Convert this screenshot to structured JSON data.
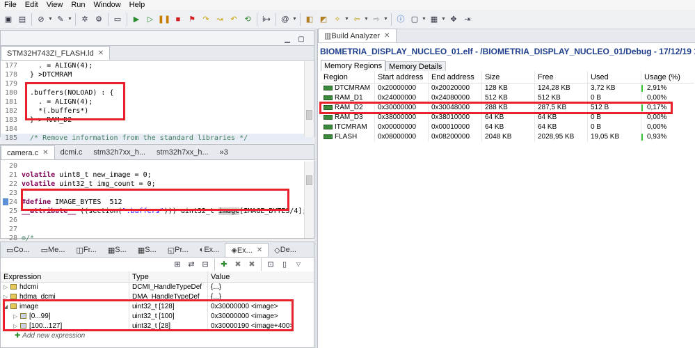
{
  "menu": [
    "File",
    "Edit",
    "Source",
    "Refactor",
    "Navigate",
    "Search",
    "Project",
    "Run",
    "Window",
    "Help"
  ],
  "menu_visible": [
    "File",
    "Edit",
    "View",
    "Run",
    "Window",
    "Help"
  ],
  "linker_editor": {
    "tab_label": "STM32H743ZI_FLASH.ld",
    "lines": [
      {
        "n": "177",
        "t": "    . = ALIGN(4);"
      },
      {
        "n": "178",
        "t": "  } >DTCMRAM"
      },
      {
        "n": "179",
        "t": ""
      },
      {
        "n": "180",
        "t": "  .buffers(NOLOAD) : {"
      },
      {
        "n": "181",
        "t": "    . = ALIGN(4);"
      },
      {
        "n": "182",
        "t": "    *(.buffers*)"
      },
      {
        "n": "183",
        "t": "  } > RAM_D2"
      },
      {
        "n": "184",
        "t": ""
      },
      {
        "n": "185",
        "t": "  /* Remove information from the standard libraries */"
      }
    ]
  },
  "c_editor": {
    "tabs": [
      "camera.c",
      "dcmi.c",
      "stm32h7xx_h...",
      "stm32h7xx_h...",
      "»3"
    ],
    "lines": [
      {
        "n": "20",
        "t": ""
      },
      {
        "n": "21",
        "kw": "volatile",
        "rest": " uint8_t new_image = 0;"
      },
      {
        "n": "22",
        "kw": "volatile",
        "rest": " uint32_t img_count = 0;"
      },
      {
        "n": "23",
        "t": ""
      },
      {
        "n": "24",
        "define": "#define",
        "rest": " IMAGE_BYTES  512"
      },
      {
        "n": "25",
        "attr": "__attribute__",
        "mid": " ((section(",
        "str": "\".buffers\"",
        "mid2": "))) uint32_t ",
        "hl": "image",
        "rest": "[IMAGE_BYTES/4];"
      },
      {
        "n": "26",
        "t": ""
      },
      {
        "n": "27",
        "t": ""
      },
      {
        "n": "28",
        "t": "⊖/*"
      }
    ]
  },
  "bottom_tabs": [
    "Co...",
    "Me...",
    "Fr...",
    "S...",
    "S...",
    "Pr...",
    "Ex...",
    "Ex...",
    "De..."
  ],
  "expressions": {
    "headers": [
      "Expression",
      "Type",
      "Value"
    ],
    "rows": [
      {
        "name": "hdcmi",
        "type": "DCMI_HandleTypeDef",
        "value": "{...}",
        "indent": 0
      },
      {
        "name": "hdma_dcmi",
        "type": "DMA_HandleTypeDef",
        "value": "{...}",
        "indent": 0
      },
      {
        "name": "image",
        "type": "uint32_t [128]",
        "value": "0x30000000 <image>",
        "indent": 0
      },
      {
        "name": "[0...99]",
        "type": "uint32_t [100]",
        "value": "0x30000000 <image>",
        "indent": 1
      },
      {
        "name": "[100...127]",
        "type": "uint32_t [28]",
        "value": "0x30000190 <image+400>",
        "indent": 1
      }
    ],
    "add_label": "Add new expression"
  },
  "build_analyzer": {
    "view_tab": "Build Analyzer",
    "title": "BIOMETRIA_DISPLAY_NUCLEO_01.elf - /BIOMETRIA_DISPLAY_NUCLEO_01/Debug - 17/12/19 11:51",
    "tabs": [
      "Memory Regions",
      "Memory Details"
    ],
    "headers": [
      "Region",
      "Start address",
      "End address",
      "Size",
      "Free",
      "Used",
      "Usage (%)"
    ],
    "rows": [
      {
        "region": "DTCMRAM",
        "start": "0x20000000",
        "end": "0x20020000",
        "size": "128 KB",
        "free": "124,28 KB",
        "used": "3,72 KB",
        "usage": "2,91%",
        "usage_frac": 0.0291
      },
      {
        "region": "RAM_D1",
        "start": "0x24000000",
        "end": "0x24080000",
        "size": "512 KB",
        "free": "512 KB",
        "used": "0 B",
        "usage": "0,00%",
        "usage_frac": 0
      },
      {
        "region": "RAM_D2",
        "start": "0x30000000",
        "end": "0x30048000",
        "size": "288 KB",
        "free": "287,5 KB",
        "used": "512 B",
        "usage": "0,17%",
        "usage_frac": 0.0017
      },
      {
        "region": "RAM_D3",
        "start": "0x38000000",
        "end": "0x38010000",
        "size": "64 KB",
        "free": "64 KB",
        "used": "0 B",
        "usage": "0,00%",
        "usage_frac": 0
      },
      {
        "region": "ITCMRAM",
        "start": "0x00000000",
        "end": "0x00010000",
        "size": "64 KB",
        "free": "64 KB",
        "used": "0 B",
        "usage": "0,00%",
        "usage_frac": 0
      },
      {
        "region": "FLASH",
        "start": "0x08000000",
        "end": "0x08200000",
        "size": "2048 KB",
        "free": "2028,95 KB",
        "used": "19,05 KB",
        "usage": "0,93%",
        "usage_frac": 0.0093
      }
    ]
  },
  "colors": {
    "highlight_box": "#e8212b",
    "title_blue": "#1f3f8c",
    "usage_bar": "#37c837"
  }
}
